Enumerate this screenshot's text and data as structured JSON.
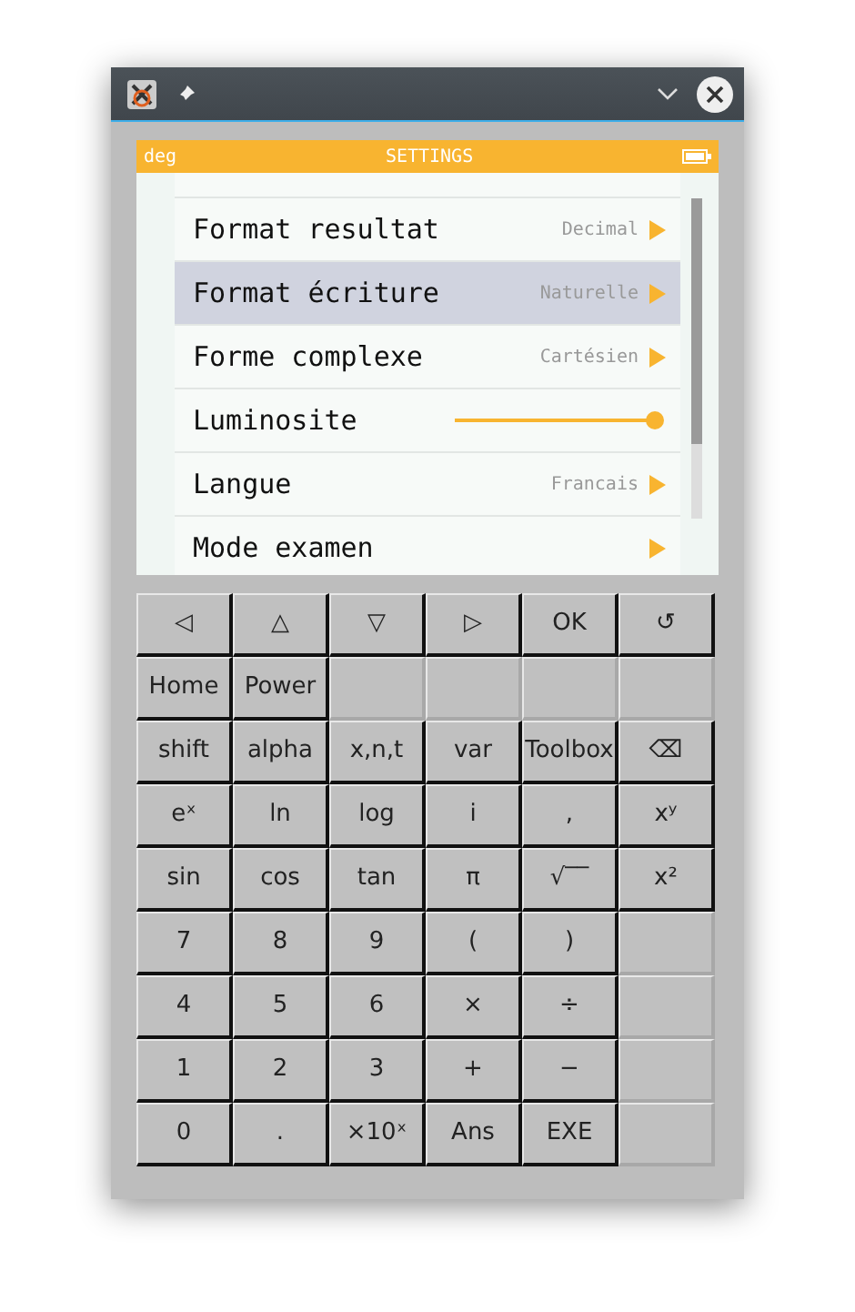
{
  "status_bar": {
    "angle_mode": "deg",
    "title": "SETTINGS"
  },
  "settings": [
    {
      "kind": "menu",
      "label": "Format resultat",
      "value": "Decimal",
      "selected": false
    },
    {
      "kind": "menu",
      "label": "Format écriture",
      "value": "Naturelle",
      "selected": true
    },
    {
      "kind": "menu",
      "label": "Forme complexe",
      "value": "Cartésien",
      "selected": false
    },
    {
      "kind": "slider",
      "label": "Luminosite",
      "level": 1.0,
      "selected": false
    },
    {
      "kind": "menu",
      "label": "Langue",
      "value": "Francais",
      "selected": false
    },
    {
      "kind": "menu",
      "label": "Mode examen",
      "selected": false
    }
  ],
  "keypad": [
    [
      {
        "label": "◁"
      },
      {
        "label": "△"
      },
      {
        "label": "▽"
      },
      {
        "label": "▷"
      },
      {
        "label": "OK"
      },
      {
        "label": "↺"
      }
    ],
    [
      {
        "label": "Home"
      },
      {
        "label": "Power"
      },
      {
        "kind": "blank"
      },
      {
        "kind": "blank"
      },
      {
        "kind": "blank"
      },
      {
        "kind": "blank"
      }
    ],
    [
      {
        "label": "shift"
      },
      {
        "label": "alpha"
      },
      {
        "label": "x,n,t"
      },
      {
        "label": "var"
      },
      {
        "label": "Toolbox"
      },
      {
        "label": "⌫"
      }
    ],
    [
      {
        "label": "eˣ"
      },
      {
        "label": "ln"
      },
      {
        "label": "log"
      },
      {
        "label": "i"
      },
      {
        "label": ","
      },
      {
        "label": "xʸ"
      }
    ],
    [
      {
        "label": "sin"
      },
      {
        "label": "cos"
      },
      {
        "label": "tan"
      },
      {
        "label": "π"
      },
      {
        "label": "√‾‾"
      },
      {
        "label": "x²"
      }
    ],
    [
      {
        "label": "7"
      },
      {
        "label": "8"
      },
      {
        "label": "9"
      },
      {
        "label": "("
      },
      {
        "label": ")"
      },
      {
        "kind": "blank"
      }
    ],
    [
      {
        "label": "4"
      },
      {
        "label": "5"
      },
      {
        "label": "6"
      },
      {
        "label": "×"
      },
      {
        "label": "÷"
      },
      {
        "kind": "blank"
      }
    ],
    [
      {
        "label": "1"
      },
      {
        "label": "2"
      },
      {
        "label": "3"
      },
      {
        "label": "+"
      },
      {
        "label": "−"
      },
      {
        "kind": "blank"
      }
    ],
    [
      {
        "label": "0"
      },
      {
        "label": "."
      },
      {
        "label": "×10ˣ"
      },
      {
        "label": "Ans"
      },
      {
        "label": "EXE"
      },
      {
        "kind": "blank"
      }
    ]
  ]
}
